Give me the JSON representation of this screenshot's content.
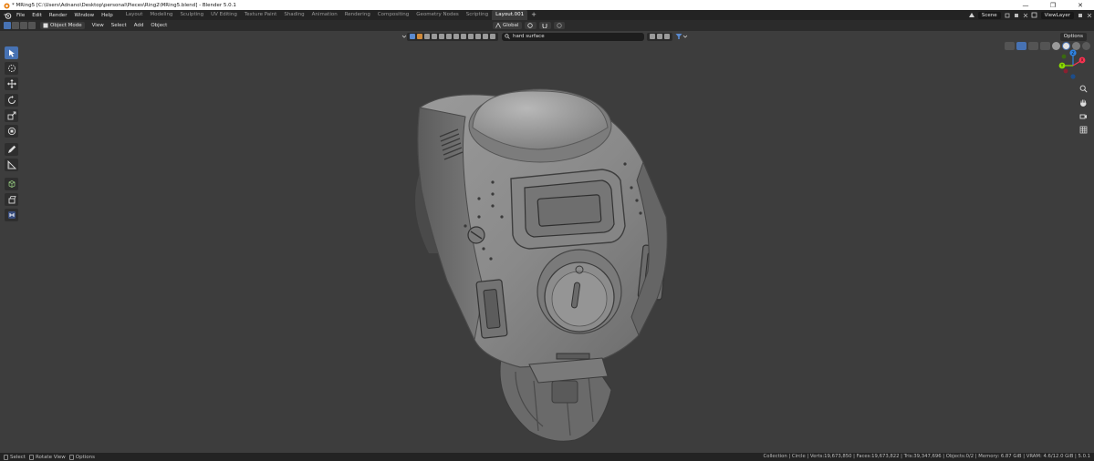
{
  "window": {
    "title": "* MRing5 [C:\\Users\\Adnano\\Desktop\\personal\\Pieces\\Ring2\\MRing5.blend] - Blender 5.0.1",
    "controls": [
      "—",
      "❐",
      "✕"
    ]
  },
  "menubar": {
    "items": [
      "File",
      "Edit",
      "Render",
      "Window",
      "Help"
    ],
    "workspaces": [
      "Layout",
      "Modeling",
      "Sculpting",
      "UV Editing",
      "Texture Paint",
      "Shading",
      "Animation",
      "Rendering",
      "Compositing",
      "Geometry Nodes",
      "Scripting",
      "Layout.001"
    ],
    "active_workspace": "Layout.001",
    "scene": "Scene",
    "view_layer": "ViewLayer"
  },
  "viewport_header": {
    "mode": "Object Mode",
    "menus": [
      "View",
      "Select",
      "Add",
      "Object"
    ],
    "transform_orientation": "Global",
    "search_text": "hard surface",
    "options_label": "Options"
  },
  "toolbar": {
    "tools": [
      "select-box",
      "cursor",
      "move",
      "rotate",
      "scale",
      "transform",
      "annotate",
      "measure",
      "add-cube",
      "extrude",
      "tool-extra"
    ]
  },
  "gizmo": {
    "axes": [
      {
        "label": "Z",
        "color": "#2f84e3"
      },
      {
        "label": "Y",
        "color": "#8bdc00"
      },
      {
        "label": "X",
        "color": "#ff3352"
      }
    ]
  },
  "statusbar": {
    "hints": [
      "Select",
      "Rotate View",
      "Options"
    ],
    "stats": "Collection | Circle | Verts:19,673,850 | Faces:19,673,822 | Tris:39,347,696 | Objects:0/2 | Memory: 6.87 GiB | VRAM: 4.6/12.0 GiB | 5.0.1"
  },
  "colors": {
    "accent": "#4772b3",
    "viewport_bg": "#3d3d3d",
    "header_bg": "#2b2b2b"
  }
}
